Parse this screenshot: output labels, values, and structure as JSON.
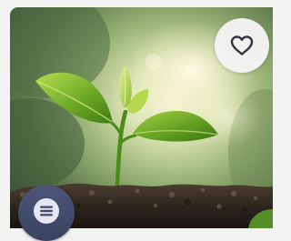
{
  "card": {
    "image_subject": "seedling-in-soil-photo",
    "favorite_icon": "heart-outline-icon",
    "menu_icon": "hamburger-menu-icon"
  },
  "colors": {
    "fav_button_bg": "#f4f4f4",
    "heart_stroke": "#2f3442",
    "menu_fab_bg": "#464f6f",
    "menu_inner_bg": "#e4e7ef",
    "menu_lines": "#464f6f"
  }
}
